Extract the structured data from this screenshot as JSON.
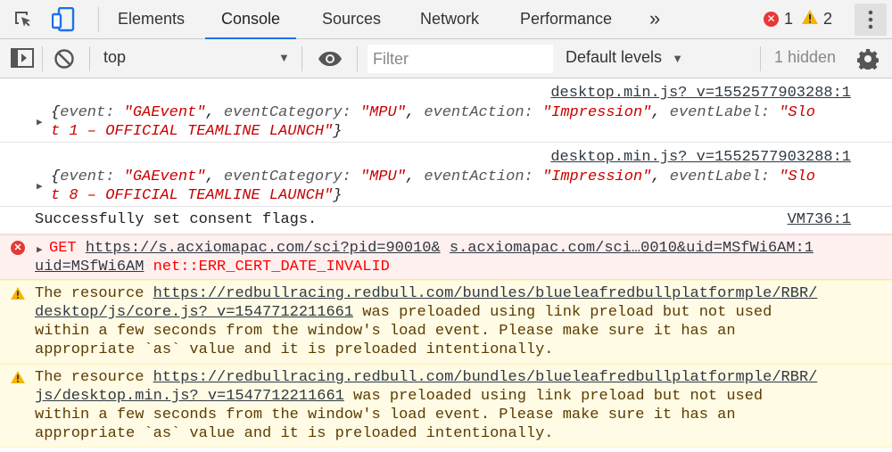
{
  "tabs": [
    "Elements",
    "Console",
    "Sources",
    "Network",
    "Performance"
  ],
  "more_tabs": "»",
  "error_count": "1",
  "warning_count": "2",
  "toolbar": {
    "context": "top",
    "filter_placeholder": "Filter",
    "levels": "Default levels",
    "hidden": "1 hidden"
  },
  "messages": [
    {
      "source": "desktop.min.js?_v=1552577903288:1",
      "object": {
        "open": "{",
        "k1": "event: ",
        "v1": "\"GAEvent\"",
        "k2": "eventCategory: ",
        "v2": "\"MPU\"",
        "k3": "eventAction: ",
        "v3": "\"Impression\"",
        "k4": "eventLabel: ",
        "v4a": "\"Slo",
        "v4b": "t 1 – OFFICIAL TEAMLINE LAUNCH\"",
        "close": "}"
      }
    },
    {
      "source": "desktop.min.js?_v=1552577903288:1",
      "object": {
        "open": "{",
        "k1": "event: ",
        "v1": "\"GAEvent\"",
        "k2": "eventCategory: ",
        "v2": "\"MPU\"",
        "k3": "eventAction: ",
        "v3": "\"Impression\"",
        "k4": "eventLabel: ",
        "v4a": "\"Slo",
        "v4b": "t 8 – OFFICIAL TEAMLINE LAUNCH\"",
        "close": "}"
      }
    },
    {
      "text": "Successfully set consent flags.",
      "source": "VM736:1"
    },
    {
      "method": "GET",
      "url1": "https://s.acxiomapac.com/sci?pid=90010&",
      "url2": "s.acxiomapac.com/sci…0010&uid=MSfWi6AM:1",
      "url1b": "uid=MSfWi6AM",
      "error": "net::ERR_CERT_DATE_INVALID"
    },
    {
      "prefix": "The resource ",
      "url_a": "https://redbullracing.redbull.com/bundles/blueleafredbullplatformple/RBR/",
      "url_b": "desktop/js/core.js?_v=1547712211661",
      "rest1": " was preloaded using link preload but not used",
      "rest2": "within a few seconds from the window's load event. Please make sure it has an",
      "rest3": "appropriate `as` value and it is preloaded intentionally."
    },
    {
      "prefix": "The resource ",
      "url_a": "https://redbullracing.redbull.com/bundles/blueleafredbullplatformple/RBR/",
      "url_b": "js/desktop.min.js?_v=1547712211661",
      "rest1": " was preloaded using link preload but not used",
      "rest2": "within a few seconds from the window's load event. Please make sure it has an",
      "rest3": "appropriate `as` value and it is preloaded intentionally."
    }
  ],
  "colors": {
    "accent": "#1a73e8",
    "error": "#ff0000",
    "warning_text": "#5c3c00",
    "string": "#c80000"
  }
}
